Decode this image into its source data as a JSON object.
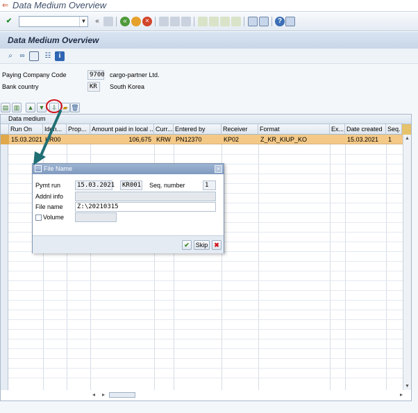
{
  "window": {
    "title": "Data Medium Overview"
  },
  "page_header": {
    "title": "Data Medium Overview"
  },
  "header_fields": {
    "paying_company_code_label": "Paying Company Code",
    "paying_company_code_value": "9700",
    "paying_company_name": "cargo-partner Ltd.",
    "bank_country_label": "Bank country",
    "bank_country_value": "KR",
    "bank_country_name": "South Korea"
  },
  "grid": {
    "title": "Data medium",
    "columns": [
      "Run On",
      "Iden...",
      "Prop...",
      "Amount paid in local ...",
      "Curr...",
      "Entered by",
      "Receiver",
      "Format",
      "Ex...",
      "Date created",
      "Seq."
    ],
    "rows": [
      {
        "run_on": "15.03.2021",
        "iden": "KR00",
        "prop": "",
        "amount": "106,675",
        "curr": "KRW",
        "entered_by": "PN12370",
        "receiver": "KP02",
        "format": "Z_KR_KIUP_KO",
        "ex": "",
        "date_created": "15.03.2021",
        "seq": "1"
      }
    ]
  },
  "dialog": {
    "title": "File Name",
    "pymt_run_label": "Pymt run",
    "pymt_run_date": "15.03.2021",
    "pymt_run_id": "KR001",
    "seq_number_label": "Seq. number",
    "seq_number_value": "1",
    "addnl_info_label": "Addnl info",
    "addnl_info_value": "",
    "file_name_label": "File name",
    "file_name_value": "Z:\\20210315",
    "volume_label": "Volume",
    "volume_value": "",
    "skip_label": "Skip"
  },
  "colors": {
    "selected_row": "#f4c987",
    "highlight_circle": "#d0141b",
    "arrow": "#1f6f74"
  }
}
